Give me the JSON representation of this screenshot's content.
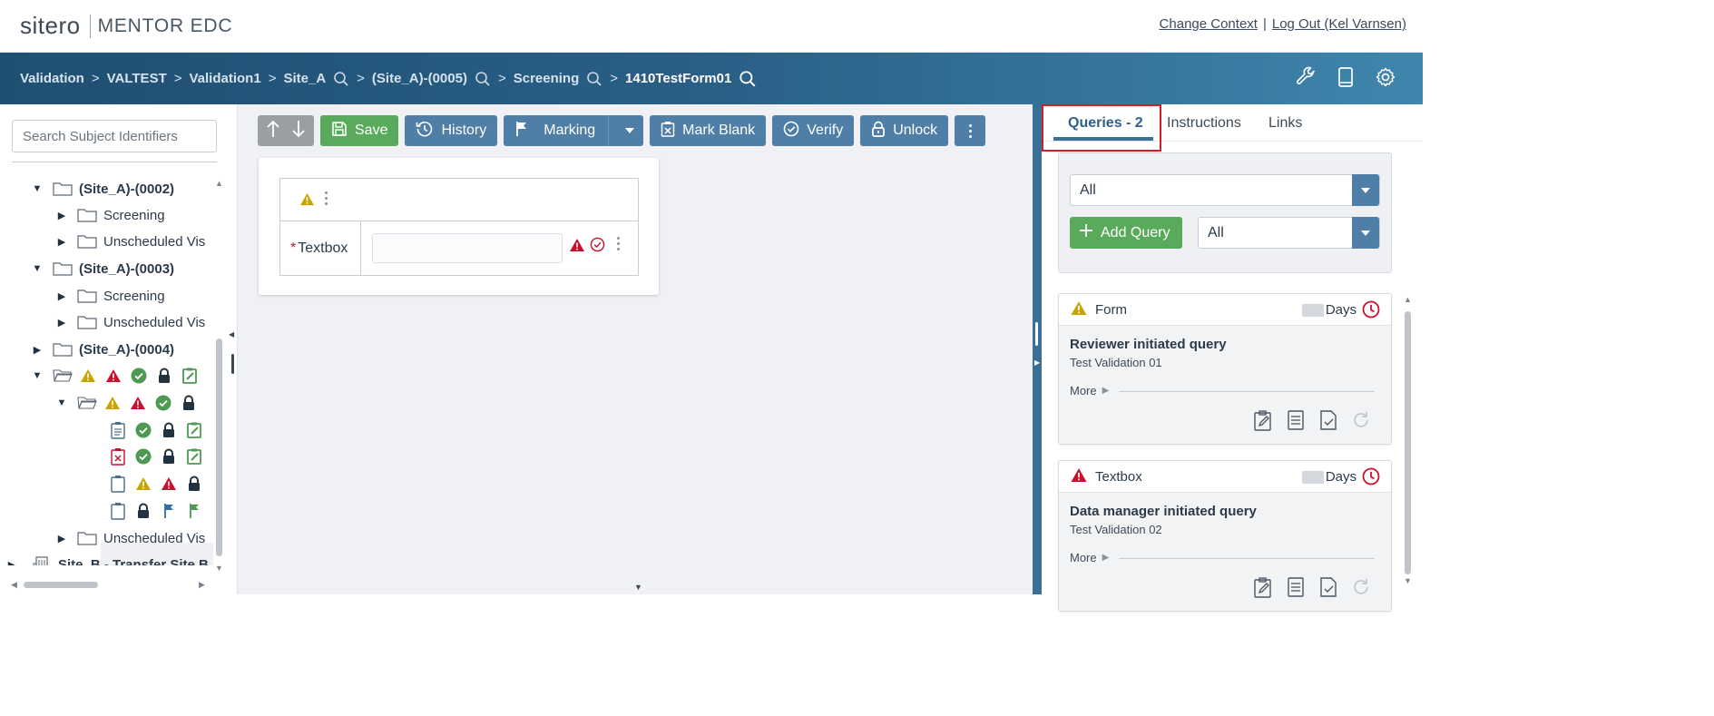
{
  "header": {
    "brand": "sitero",
    "product": "MENTOR EDC",
    "links": [
      "Change Context",
      "Log Out (Kel Varnsen)"
    ],
    "separator": "|"
  },
  "breadcrumb": {
    "items": [
      "Validation",
      "VALTEST",
      "Validation1",
      "Site_A",
      "(Site_A)-(0005)",
      "Screening",
      "1410TestForm01"
    ],
    "separator": ">"
  },
  "sidebar": {
    "search_placeholder": "Search Subject Identifiers",
    "tree": [
      {
        "label": "(Site_A)-(0002)",
        "bold": true
      },
      {
        "label": "Screening"
      },
      {
        "label": "Unscheduled Vis"
      },
      {
        "label": "(Site_A)-(0003)",
        "bold": true
      },
      {
        "label": "Screening"
      },
      {
        "label": "Unscheduled Vis"
      },
      {
        "label": "(Site_A)-(0004)",
        "bold": true
      },
      {
        "label": "Unscheduled Vis"
      },
      {
        "label": "Site_B - Transfer Site B",
        "bold": true
      }
    ]
  },
  "toolbar": {
    "save": "Save",
    "history": "History",
    "marking": "Marking",
    "mark_blank": "Mark Blank",
    "verify": "Verify",
    "unlock": "Unlock"
  },
  "form": {
    "field_label": "Textbox",
    "required_mark": "*",
    "field_value": ""
  },
  "rpanel": {
    "tabs": [
      "Queries - 2",
      "Instructions",
      "Links"
    ],
    "filter_status": "All",
    "filter_type": "All",
    "add_query": "Add Query",
    "queries": [
      {
        "target": "Form",
        "days_label": "Days",
        "title": "Reviewer initiated query",
        "author": "Test Validation 01",
        "more": "More",
        "severity": "warning"
      },
      {
        "target": "Textbox",
        "days_label": "Days",
        "title": "Data manager initiated query",
        "author": "Test Validation 02",
        "more": "More",
        "severity": "error"
      }
    ]
  },
  "colors": {
    "accent": "#3a6f96",
    "green": "#5aaa5b",
    "warning": "#c9a300",
    "error": "#c8102e"
  }
}
